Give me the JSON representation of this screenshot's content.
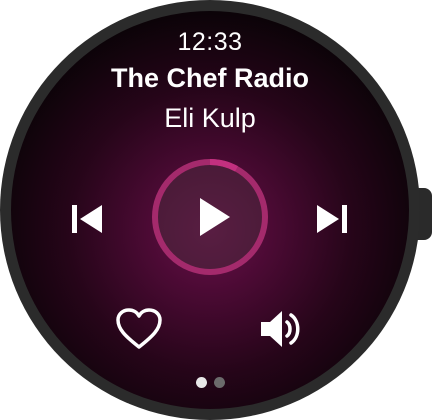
{
  "status": {
    "time": "12:33"
  },
  "now_playing": {
    "title": "The Chef Radio",
    "artist": "Eli Kulp",
    "progress": 0.08,
    "state": "paused"
  },
  "controls": {
    "previous_icon": "skip-previous-icon",
    "play_icon": "play-icon",
    "next_icon": "skip-next-icon",
    "like_icon": "heart-outline-icon",
    "volume_icon": "volume-icon"
  },
  "pager": {
    "pages": 2,
    "current": 1
  },
  "colors": {
    "accent": "#c2307f",
    "ring_track": "#a42a6c",
    "background_center": "#6a0f4a",
    "text": "#ffffff"
  }
}
